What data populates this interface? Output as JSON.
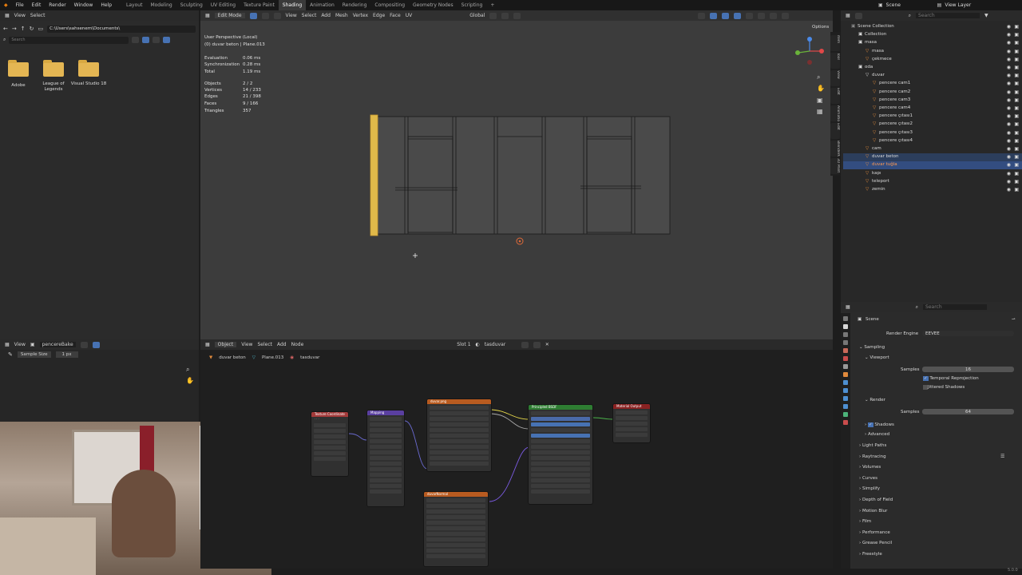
{
  "menubar": {
    "items": [
      "File",
      "Edit",
      "Render",
      "Window",
      "Help"
    ],
    "workspaces": [
      "Layout",
      "Modeling",
      "Sculpting",
      "UV Editing",
      "Texture Paint",
      "Shading",
      "Animation",
      "Rendering",
      "Compositing",
      "Geometry Nodes",
      "Scripting"
    ],
    "active_workspace": "Shading",
    "scene": "Scene",
    "view_layer": "View Layer"
  },
  "file_browser": {
    "header": [
      "View",
      "Select"
    ],
    "path": "C:\\Users\\sahsenem\\Documents\\",
    "search_placeholder": "Search",
    "folders": [
      {
        "label": "Adobe"
      },
      {
        "label": "League of Legends"
      },
      {
        "label": "Visual Studio 18"
      }
    ]
  },
  "image_editor": {
    "header": [
      "View"
    ],
    "image_name": "pencereBake",
    "sample_size_label": "Sample Size",
    "sample_size_value": "1 px"
  },
  "viewport": {
    "mode": "Edit Mode",
    "menus": [
      "View",
      "Select",
      "Add",
      "Mesh",
      "Vertex",
      "Edge",
      "Face",
      "UV"
    ],
    "transform_orientation": "Global",
    "options_label": "Options",
    "view_name": "User Perspective (Local)",
    "object_info": "(0) duvar beton | Plane.013",
    "stats": [
      {
        "label": "Evaluation",
        "value": "0.06 ms"
      },
      {
        "label": "Synchronization",
        "value": "0.28 ms"
      },
      {
        "label": "Total",
        "value": "1.19 ms"
      },
      {
        "label": "Objects",
        "value": "2 / 2"
      },
      {
        "label": "Vertices",
        "value": "14 / 233"
      },
      {
        "label": "Edges",
        "value": "21 / 398"
      },
      {
        "label": "Faces",
        "value": "9 / 166"
      },
      {
        "label": "Triangles",
        "value": "357"
      }
    ],
    "side_tabs": [
      "Item",
      "Tool",
      "View",
      "Edit",
      "Animation",
      "Edit",
      "BlenderKit",
      "3D Print"
    ]
  },
  "outliner": {
    "search_placeholder": "Search",
    "items": [
      {
        "label": "Scene Collection",
        "depth": 0
      },
      {
        "label": "Collection",
        "depth": 1
      },
      {
        "label": "masa",
        "depth": 1
      },
      {
        "label": "masa",
        "depth": 2
      },
      {
        "label": "çekmece",
        "depth": 2
      },
      {
        "label": "oda",
        "depth": 1
      },
      {
        "label": "duvar",
        "depth": 2
      },
      {
        "label": "pencere cam1",
        "depth": 3
      },
      {
        "label": "pencere cam2",
        "depth": 3
      },
      {
        "label": "pencere cam3",
        "depth": 3
      },
      {
        "label": "pencere cam4",
        "depth": 3
      },
      {
        "label": "pencere çıtası1",
        "depth": 3
      },
      {
        "label": "pencere çıtası2",
        "depth": 3
      },
      {
        "label": "pencere çıtası3",
        "depth": 3
      },
      {
        "label": "pencere çıtası4",
        "depth": 3
      },
      {
        "label": "cam",
        "depth": 2
      },
      {
        "label": "duvar beton",
        "depth": 2,
        "selected": true
      },
      {
        "label": "duvar tuğla",
        "depth": 2,
        "selected": true,
        "active": true
      },
      {
        "label": "kapı",
        "depth": 2
      },
      {
        "label": "teleport",
        "depth": 2
      },
      {
        "label": "zemin",
        "depth": 2
      }
    ]
  },
  "properties": {
    "search_placeholder": "Search",
    "scene_label": "Scene",
    "render_engine_label": "Render Engine",
    "render_engine_value": "EEVEE",
    "sections": {
      "sampling": "Sampling",
      "viewport": "Viewport",
      "viewport_samples_label": "Samples",
      "viewport_samples_value": "16",
      "temporal_reprojection": "Temporal Reprojection",
      "jittered_shadows": "Jittered Shadows",
      "render": "Render",
      "render_samples_label": "Samples",
      "render_samples_value": "64",
      "shadows": "Shadows",
      "advanced": "Advanced"
    },
    "panels": [
      "Light Paths",
      "Raytracing",
      "Volumes",
      "Curves",
      "Simplify",
      "Depth of Field",
      "Motion Blur",
      "Film",
      "Performance",
      "Grease Pencil",
      "Freestyle"
    ],
    "version": "5.0.0"
  },
  "node_editor": {
    "header": [
      "Object",
      "View",
      "Select",
      "Add",
      "Node"
    ],
    "slot": "Slot 1",
    "material": "tasduvar",
    "breadcrumb": [
      "duvar beton",
      "Plane.013",
      "tasduvar"
    ],
    "nodes": [
      {
        "title": "Texture Coordinate",
        "color": "#a33a3a"
      },
      {
        "title": "Mapping",
        "color": "#5a3fa0"
      },
      {
        "title": "duvar.png",
        "color": "#b85b20"
      },
      {
        "title": "Principled BSDF",
        "color": "#2e7d32"
      },
      {
        "title": "Material Output",
        "color": "#8a2222"
      },
      {
        "title": "duvarNormal",
        "color": "#b85b20"
      }
    ]
  }
}
